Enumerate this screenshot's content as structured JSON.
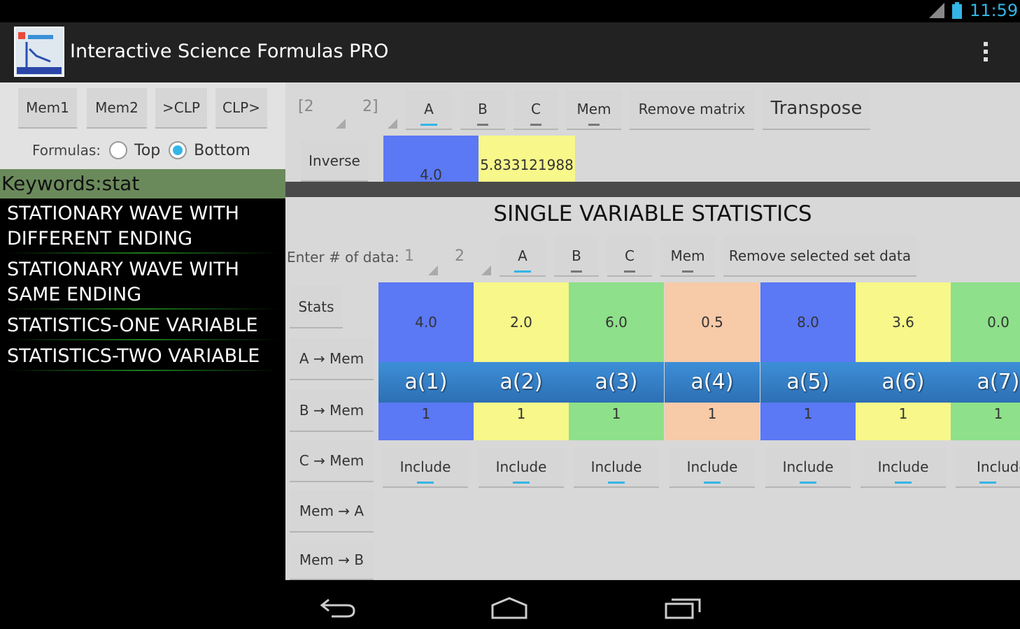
{
  "status_bar": {
    "time": "11:59",
    "signal_icon": "signal-icon",
    "battery_icon": "battery-icon"
  },
  "action_bar": {
    "title": "Interactive Science Formulas PRO",
    "app_icon": "app-logo-icon",
    "overflow_icon": "overflow-menu-icon"
  },
  "left": {
    "buttons": [
      "Mem1",
      "Mem2",
      ">CLP",
      "CLP>"
    ],
    "formulas_label": "Formulas:",
    "radio_top": "Top",
    "radio_bottom": "Bottom",
    "selected_radio": "Bottom",
    "keywords": "Keywords:stat",
    "results": [
      "STATIONARY WAVE WITH DIFFERENT ENDING",
      "STATIONARY WAVE WITH SAME ENDING",
      "STATISTICS-ONE VARIABLE",
      "STATISTICS-TWO VARIABLE"
    ]
  },
  "matrix": {
    "size_rows": "[2",
    "size_cols": "2]",
    "tabs": [
      "A",
      "B",
      "C",
      "Mem"
    ],
    "selected_tab": "A",
    "remove_label": "Remove matrix",
    "transpose_label": "Transpose",
    "inverse_label": "Inverse",
    "cell_values": [
      "4.0",
      "5.833121988"
    ]
  },
  "stats": {
    "title": "SINGLE VARIABLE STATISTICS",
    "enter_label": "Enter # of data:",
    "count_a": "1",
    "count_b": "2",
    "tabs": [
      "A",
      "B",
      "C",
      "Mem"
    ],
    "selected_tab": "A",
    "remove_label": "Remove selected set data",
    "side_buttons": [
      "Stats",
      "A → Mem",
      "B → Mem",
      "C → Mem",
      "Mem → A",
      "Mem → B"
    ],
    "columns": [
      {
        "label": "a(1)",
        "value": "4.0",
        "count": "1",
        "color": "#5b78f5"
      },
      {
        "label": "a(2)",
        "value": "2.0",
        "count": "1",
        "color": "#f7f78a"
      },
      {
        "label": "a(3)",
        "value": "6.0",
        "count": "1",
        "color": "#8ee08a"
      },
      {
        "label": "a(4)",
        "value": "0.5",
        "count": "1",
        "color": "#f7caa8"
      },
      {
        "label": "a(5)",
        "value": "8.0",
        "count": "1",
        "color": "#5b78f5"
      },
      {
        "label": "a(6)",
        "value": "3.6",
        "count": "1",
        "color": "#f7f78a"
      },
      {
        "label": "a(7)",
        "value": "0.0",
        "count": "1",
        "color": "#8ee08a"
      }
    ],
    "include_label": "Include"
  },
  "nav": {
    "back_icon": "back-icon",
    "home_icon": "home-icon",
    "recents_icon": "recent-apps-icon"
  }
}
